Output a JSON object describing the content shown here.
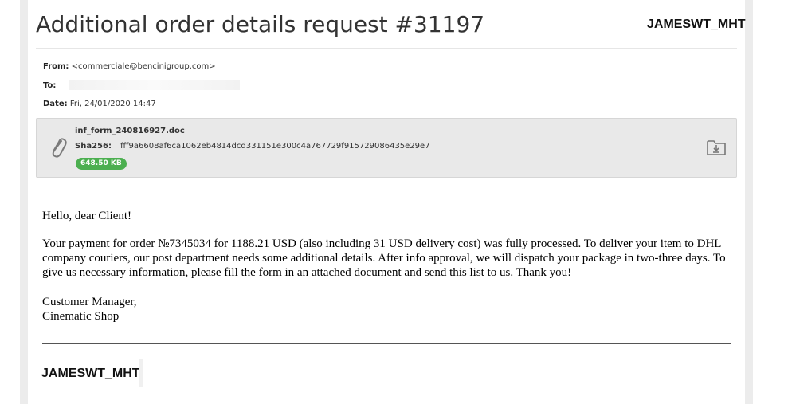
{
  "email": {
    "subject": "Additional order details request #31197",
    "from_label": "From:",
    "from_value": "<commerciale@bencinigroup.com>",
    "to_label": "To:",
    "to_value": "",
    "date_label": "Date:",
    "date_value": "Fri, 24/01/2020 14:47"
  },
  "watermark": "JAMESWT_MHT",
  "attachment": {
    "filename": "inf_form_240816927.doc",
    "sha_label": "Sha256:",
    "sha_value": "fff9a6608af6ca1062eb4814dcd331151e300c4a767729f915729086435e29e7",
    "size": "648.50 KB",
    "icon": "paperclip-icon",
    "action_icon": "download-icon",
    "badge_color": "#4caf50"
  },
  "body": {
    "greeting": "Hello, dear Client!",
    "paragraph": "Your payment for order №7345034 for 1188.21 USD (also including 31 USD delivery cost) was fully processed. To deliver your item to DHL company couriers, our post department needs some additional details. After info approval, we will dispatch your package in two-three days. To give us necessary information, please fill the form in an attached document and send this list to us. Thank you!",
    "signature_line1": "Customer Manager,",
    "signature_line2": "Cinematic Shop"
  }
}
